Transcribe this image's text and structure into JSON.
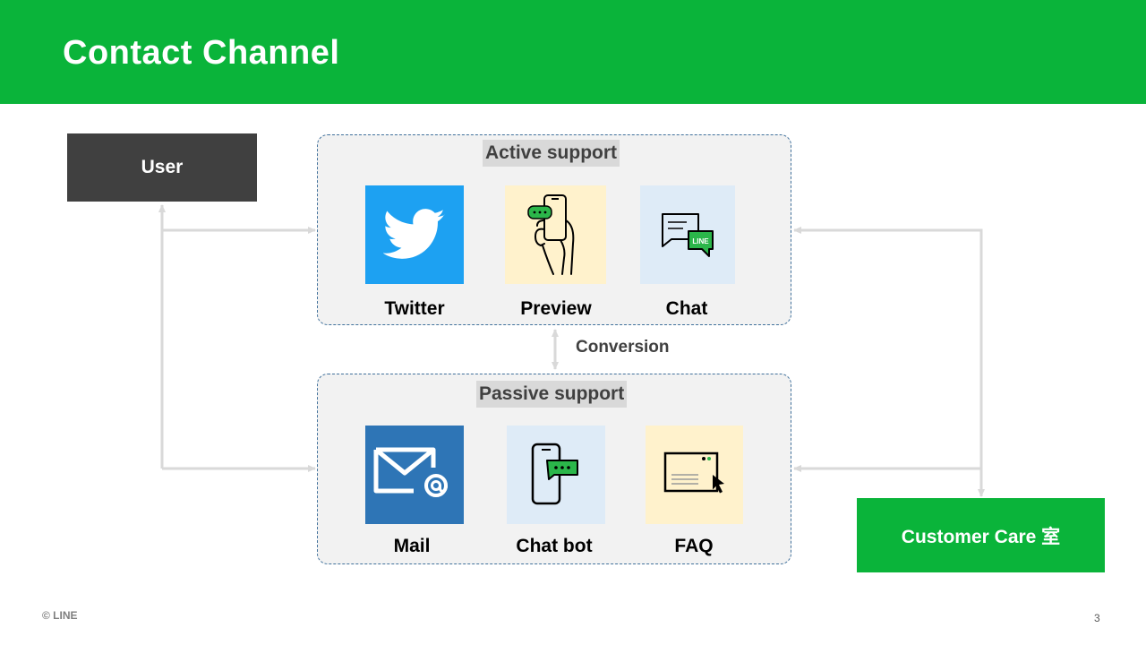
{
  "slide": {
    "title": "Contact Channel",
    "page_number": "3",
    "footer_logo": "© LINE"
  },
  "nodes": {
    "user": "User",
    "customer_care": "Customer Care 室"
  },
  "active_support": {
    "title": "Active support",
    "items": [
      {
        "label": "Twitter",
        "icon": "twitter-bird-icon"
      },
      {
        "label": "Preview",
        "icon": "hand-phone-chat-icon"
      },
      {
        "label": "Chat",
        "icon": "line-chat-bubbles-icon"
      }
    ]
  },
  "passive_support": {
    "title": "Passive support",
    "items": [
      {
        "label": "Mail",
        "icon": "envelope-at-icon"
      },
      {
        "label": "Chat bot",
        "icon": "phone-chat-icon"
      },
      {
        "label": "FAQ",
        "icon": "browser-cursor-icon"
      }
    ]
  },
  "conversion_label": "Conversion",
  "colors": {
    "line_green": "#0ab43a",
    "user_box": "#404040",
    "twitter_blue": "#1da1f2",
    "mail_blue": "#2e75b6",
    "tile_cream": "#fff2cc",
    "tile_lightblue": "#deebf7",
    "connector_gray": "#d9d9d9"
  }
}
